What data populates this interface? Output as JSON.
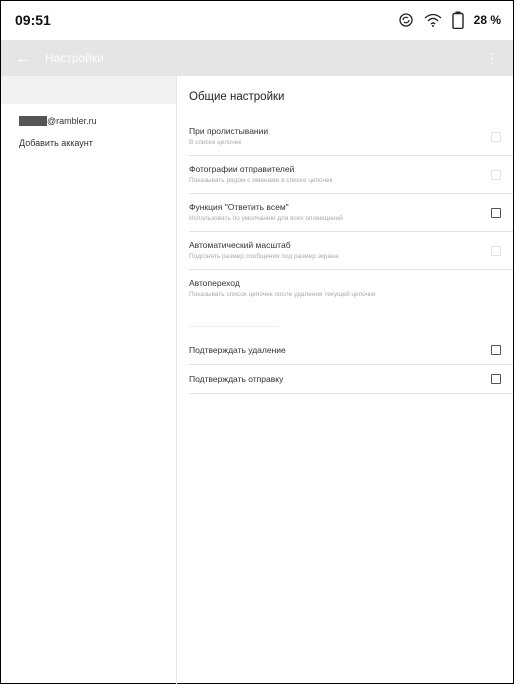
{
  "status_bar": {
    "time": "09:51",
    "battery_percent": "28 %",
    "icons": [
      "sync-icon",
      "wifi-icon",
      "battery-icon"
    ]
  },
  "toolbar": {
    "title": "Настройки",
    "back_icon": "arrow-left-icon",
    "menu_icon": "more-vertical-icon"
  },
  "sidebar": {
    "header_label": "",
    "account_domain": "@rambler.ru",
    "add_account": "Добавить аккаунт"
  },
  "main": {
    "section_title": "Общие настройки",
    "settings": [
      {
        "title": "При пролистывании",
        "subtitle": "В списке цепочек",
        "checkbox": "disabled"
      },
      {
        "title": "Фотографии отправителей",
        "subtitle": "Показывать рядом с именами в списке цепочек",
        "checkbox": "disabled"
      },
      {
        "title": "Функция \"Ответить всем\"",
        "subtitle": "Использовать по умолчанию для всех оповещений",
        "checkbox": "unchecked"
      },
      {
        "title": "Автоматический масштаб",
        "subtitle": "Подгонять размер сообщения под размер экрана",
        "checkbox": "disabled"
      },
      {
        "title": "Автопереход",
        "subtitle": "Показывать список цепочек после удаления текущей цепочки"
      }
    ],
    "toggles": [
      {
        "title": "Подтверждать удаление",
        "checked": false
      },
      {
        "title": "Подтверждать отправку",
        "checked": false
      }
    ]
  }
}
